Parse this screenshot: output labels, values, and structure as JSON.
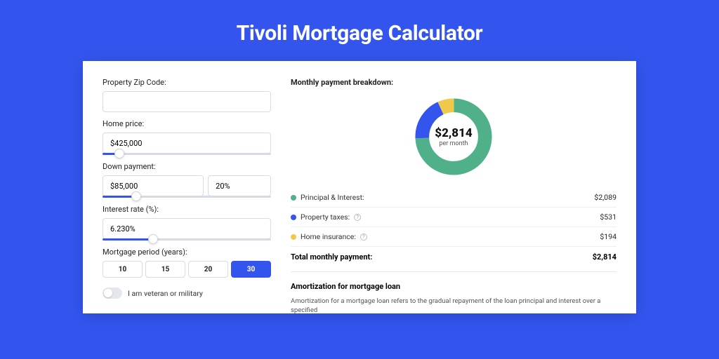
{
  "title": "Tivoli Mortgage Calculator",
  "form": {
    "zip": {
      "label": "Property Zip Code:",
      "value": ""
    },
    "home_price": {
      "label": "Home price:",
      "value": "$425,000",
      "slider_pct": 10
    },
    "down_payment": {
      "label": "Down payment:",
      "amount": "$85,000",
      "pct": "20%",
      "slider_pct": 20
    },
    "interest": {
      "label": "Interest rate (%):",
      "value": "6.230%",
      "slider_pct": 30
    },
    "period": {
      "label": "Mortgage period (years):",
      "options": [
        "10",
        "15",
        "20",
        "30"
      ],
      "active": 3
    },
    "veteran": {
      "label": "I am veteran or military",
      "on": false
    }
  },
  "breakdown": {
    "title": "Monthly payment breakdown:",
    "center_amount": "$2,814",
    "center_label": "per month",
    "items": [
      {
        "label": "Principal & Interest:",
        "value": "$2,089",
        "color": "green",
        "info": false
      },
      {
        "label": "Property taxes:",
        "value": "$531",
        "color": "blue",
        "info": true
      },
      {
        "label": "Home insurance:",
        "value": "$194",
        "color": "yellow",
        "info": true
      }
    ],
    "total_label": "Total monthly payment:",
    "total_value": "$2,814"
  },
  "chart_data": {
    "type": "pie",
    "title": "Monthly payment breakdown",
    "categories": [
      "Principal & Interest",
      "Property taxes",
      "Home insurance"
    ],
    "values": [
      2089,
      531,
      194
    ],
    "colors": [
      "#4fb08a",
      "#3355ee",
      "#f0c94a"
    ],
    "center_value": 2814,
    "center_unit": "per month"
  },
  "amortization": {
    "title": "Amortization for mortgage loan",
    "body": "Amortization for a mortgage loan refers to the gradual repayment of the loan principal and interest over a specified"
  }
}
